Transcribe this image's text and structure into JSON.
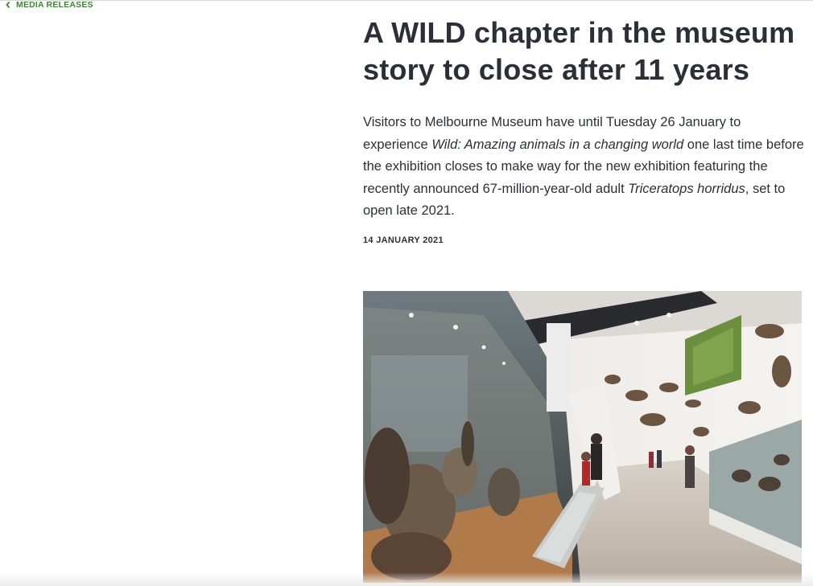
{
  "nav": {
    "back_label": "MEDIA RELEASES"
  },
  "article": {
    "title": "A WILD chapter in the museum story to close after 11 years",
    "lead_part1": "Visitors to Melbourne Museum have until Tuesday 26 January to experience ",
    "lead_em1": "Wild: Amazing animals in a changing world",
    "lead_part2": " one last time before the exhibition closes to make way for the new exhibition featuring the recently announced 67-million-year-old adult ",
    "lead_em2": "Triceratops horridus",
    "lead_part3": ", set to open late 2021.",
    "date": "14 JANUARY 2021"
  },
  "colors": {
    "accent_green": "#3a8a2e",
    "text": "#2d2f38"
  },
  "icons": {
    "back": "chevron-left-icon"
  }
}
